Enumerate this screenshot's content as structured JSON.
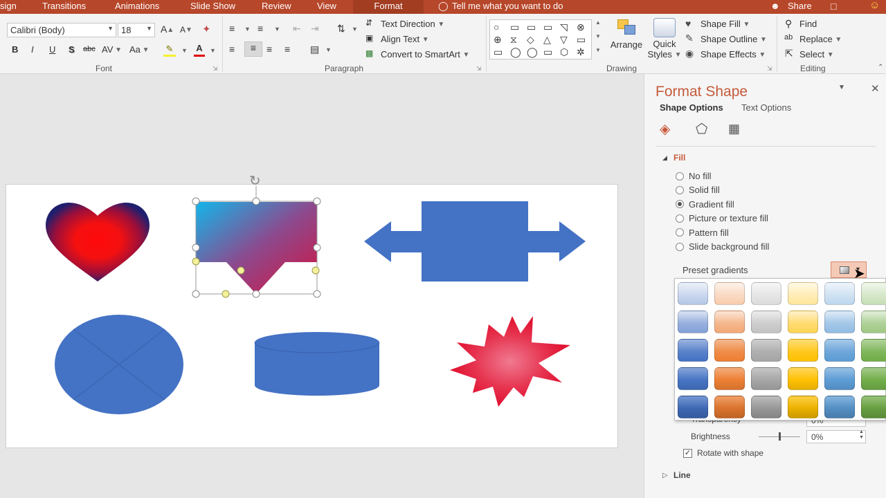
{
  "tabs": [
    {
      "label": "sign",
      "active": false
    },
    {
      "label": "Transitions",
      "active": false
    },
    {
      "label": "Animations",
      "active": false
    },
    {
      "label": "Slide Show",
      "active": false
    },
    {
      "label": "Review",
      "active": false
    },
    {
      "label": "View",
      "active": false
    },
    {
      "label": "Format",
      "active": true
    }
  ],
  "tell_me": "Tell me what you want to do",
  "share": "Share",
  "font": {
    "name": "Calibri (Body)",
    "size": "18",
    "bold": "B",
    "italic": "I",
    "underline": "U",
    "shadow": "S",
    "strike": "abc",
    "spacing": "AV",
    "case": "Aa",
    "grow": "A",
    "shrink": "A",
    "group_label": "Font"
  },
  "paragraph": {
    "text_direction": "Text Direction",
    "align_text": "Align Text",
    "convert_smartart": "Convert to SmartArt",
    "group_label": "Paragraph"
  },
  "drawing": {
    "arrange": "Arrange",
    "quick": "Quick",
    "styles": "Styles",
    "shape_fill": "Shape Fill",
    "shape_outline": "Shape Outline",
    "shape_effects": "Shape Effects",
    "group_label": "Drawing",
    "shape_glyphs": [
      "○",
      "▭",
      "▭",
      "▭",
      "◹",
      "⊗",
      "⊕",
      "⧖",
      "◇",
      "△",
      "▽",
      "▭",
      "▭",
      "◯",
      "◯",
      "▭",
      "◯",
      "⬡",
      "✲",
      "✹"
    ]
  },
  "editing": {
    "find": "Find",
    "replace": "Replace",
    "select": "Select",
    "group_label": "Editing"
  },
  "pane": {
    "title": "Format Shape",
    "tab_shape": "Shape Options",
    "tab_text": "Text Options",
    "fill_header": "Fill",
    "options": [
      {
        "label": "No fill",
        "selected": false
      },
      {
        "label": "Solid fill",
        "selected": false
      },
      {
        "label": "Gradient fill",
        "selected": true
      },
      {
        "label": "Picture or texture fill",
        "selected": false
      },
      {
        "label": "Pattern fill",
        "selected": false
      },
      {
        "label": "Slide background fill",
        "selected": false
      }
    ],
    "preset_label": "Preset gradients",
    "transparency_label": "Transparency",
    "transparency_value": "0%",
    "brightness_label": "Brightness",
    "brightness_value": "0%",
    "rotate_label": "Rotate with shape",
    "line_header": "Line"
  },
  "gradient_columns": [
    "#4472c4",
    "#ed7d31",
    "#a5a5a5",
    "#ffc000",
    "#5b9bd5",
    "#70ad47"
  ],
  "colors": {
    "accent": "#b7472a",
    "pane_title": "#c55a3b",
    "shape_blue": "#4472c4",
    "heart_outer": "#1f1f6e",
    "heart_inner": "#ff0a0a",
    "star_outer": "#e0102e",
    "star_inner": "#f07a90"
  }
}
